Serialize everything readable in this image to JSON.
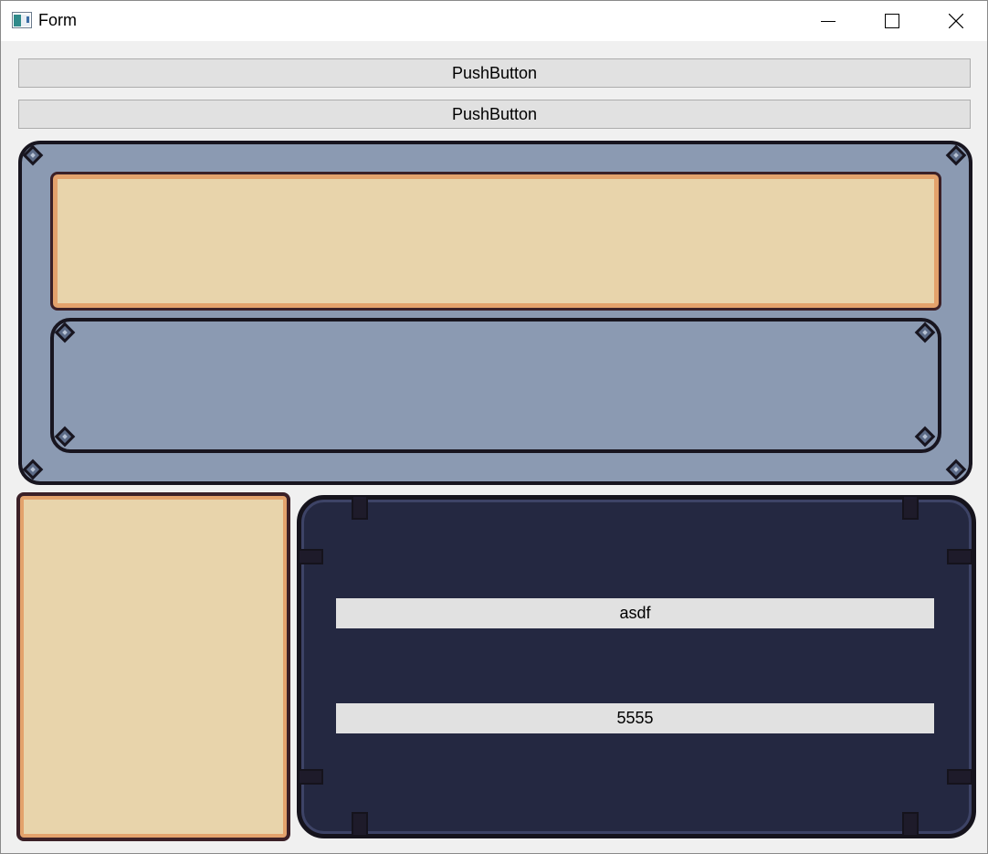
{
  "window": {
    "title": "Form",
    "controls": [
      "minimize-icon",
      "maximize-icon",
      "close-icon"
    ]
  },
  "buttons": [
    {
      "label": "PushButton"
    },
    {
      "label": "PushButton"
    }
  ],
  "fields": [
    {
      "value": "asdf"
    },
    {
      "value": "5555"
    }
  ],
  "colors": {
    "slate_panel": "#8b9ab2",
    "cream_panel": "#e8d4ab",
    "cream_border": "#e3a26c",
    "navy_panel": "#242841",
    "dark_outline": "#18151f",
    "button_bg": "#e1e1e1"
  }
}
